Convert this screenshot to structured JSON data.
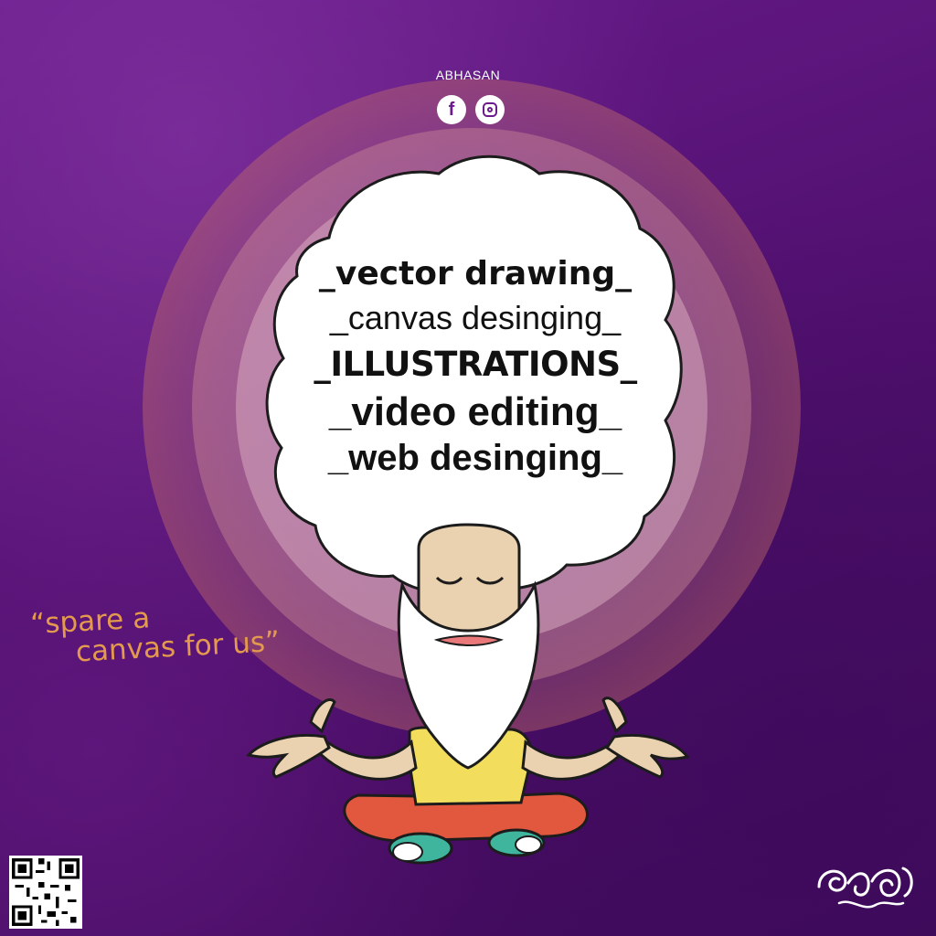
{
  "brand": {
    "name": "ABHASAN",
    "social_icons": [
      "facebook-icon",
      "instagram-icon"
    ]
  },
  "services": [
    "vector drawing",
    "canvas desinging",
    "ILLUSTRATIONS",
    "video editing",
    "web desinging"
  ],
  "quote": {
    "line1": "“spare a",
    "line2": "canvas for us”"
  },
  "colors": {
    "background": "#5a1478",
    "quote": "#e39a4e",
    "hair": "#ffffff",
    "shirt": "#f2de5c",
    "pants": "#e2583e",
    "shoes": "#3fb59e"
  },
  "illustration": {
    "subject": "meditating-sage",
    "qr": "qr-code",
    "signature": "handwritten-logo"
  }
}
